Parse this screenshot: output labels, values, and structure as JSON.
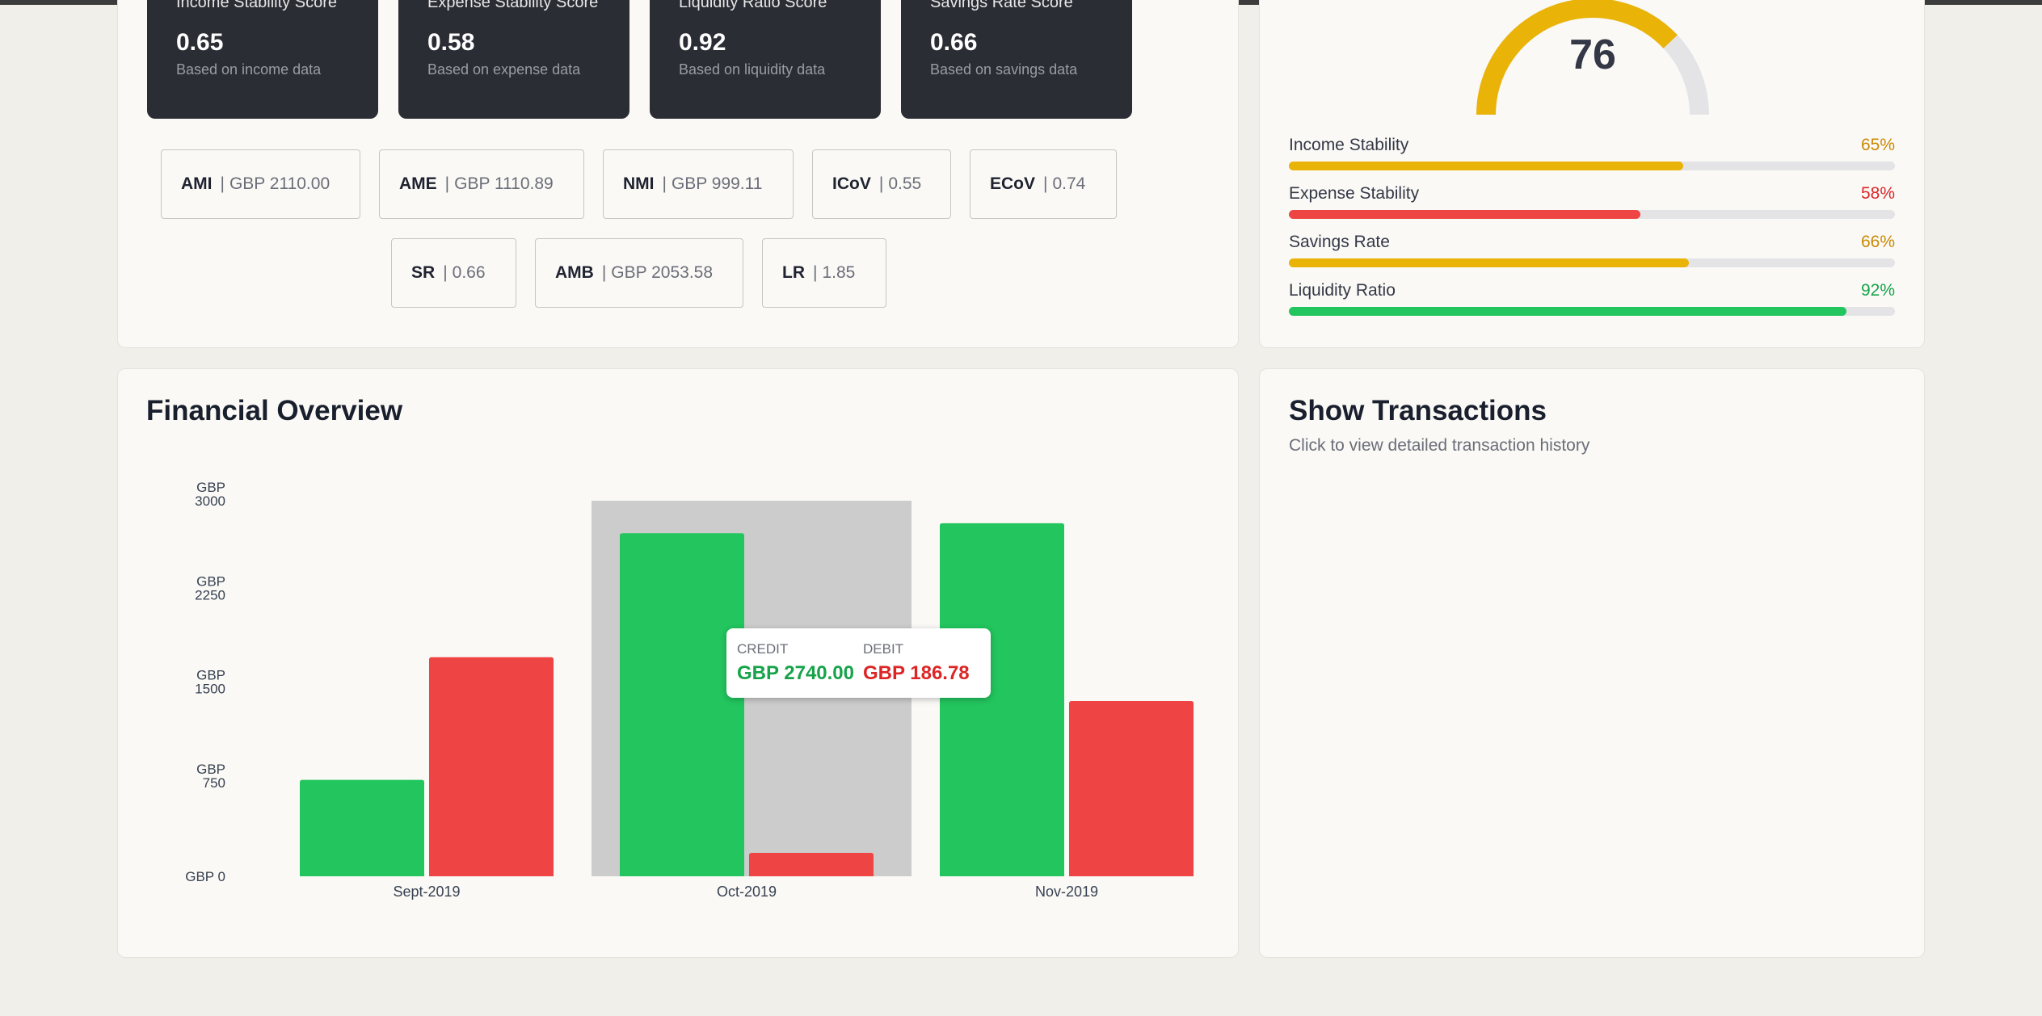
{
  "scores": [
    {
      "title": "Income Stability Score",
      "value": "0.65",
      "desc": "Based on income data"
    },
    {
      "title": "Expense Stability Score",
      "value": "0.58",
      "desc": "Based on expense data"
    },
    {
      "title": "Liquidity Ratio Score",
      "value": "0.92",
      "desc": "Based on liquidity data"
    },
    {
      "title": "Savings Rate Score",
      "value": "0.66",
      "desc": "Based on savings data"
    }
  ],
  "metrics": [
    {
      "key": "AMI",
      "sep": "|",
      "value": "GBP 2110.00"
    },
    {
      "key": "AME",
      "sep": "|",
      "value": "GBP 1110.89"
    },
    {
      "key": "NMI",
      "sep": "|",
      "value": "GBP 999.11"
    },
    {
      "key": "ICoV",
      "sep": "|",
      "value": "0.55"
    },
    {
      "key": "ECoV",
      "sep": "|",
      "value": "0.74"
    },
    {
      "key": "SR",
      "sep": "|",
      "value": "0.66"
    },
    {
      "key": "AMB",
      "sep": "|",
      "value": "GBP 2053.58"
    },
    {
      "key": "LR",
      "sep": "|",
      "value": "1.85"
    }
  ],
  "overall_score": {
    "value": "76",
    "fraction": 0.76,
    "color": "#eab308"
  },
  "breakdown": [
    {
      "label": "Income Stability",
      "percent": "65%",
      "fraction": 0.65,
      "color": "#eab308",
      "text_color": "#ca8a04"
    },
    {
      "label": "Expense Stability",
      "percent": "58%",
      "fraction": 0.58,
      "color": "#ef4444",
      "text_color": "#dc2626"
    },
    {
      "label": "Savings Rate",
      "percent": "66%",
      "fraction": 0.66,
      "color": "#eab308",
      "text_color": "#ca8a04"
    },
    {
      "label": "Liquidity Ratio",
      "percent": "92%",
      "fraction": 0.92,
      "color": "#22c55e",
      "text_color": "#16a34a"
    }
  ],
  "overview": {
    "title": "Financial Overview"
  },
  "transactions": {
    "title": "Show Transactions",
    "subtitle": "Click to view detailed transaction history"
  },
  "tooltip": {
    "credit_label": "CREDIT",
    "credit_value": "GBP 2740.00",
    "debit_label": "DEBIT",
    "debit_value": "GBP 186.78"
  },
  "colors": {
    "credit": "#22c55e",
    "debit": "#ef4444",
    "highlight": "#cccccc"
  },
  "chart_data": {
    "type": "bar",
    "categories": [
      "Sept-2019",
      "Oct-2019",
      "Nov-2019"
    ],
    "series": [
      {
        "name": "CREDIT",
        "values": [
          770,
          2740,
          2820
        ]
      },
      {
        "name": "DEBIT",
        "values": [
          1750,
          186.78,
          1400
        ]
      }
    ],
    "ylim": [
      0,
      3000
    ],
    "yticks": [
      0,
      750,
      1500,
      2250,
      3000
    ],
    "ytick_labels": [
      [
        "GBP 0"
      ],
      [
        "GBP",
        "750"
      ],
      [
        "GBP",
        "1500"
      ],
      [
        "GBP",
        "2250"
      ],
      [
        "GBP",
        "3000"
      ]
    ],
    "highlighted_category": "Oct-2019"
  }
}
